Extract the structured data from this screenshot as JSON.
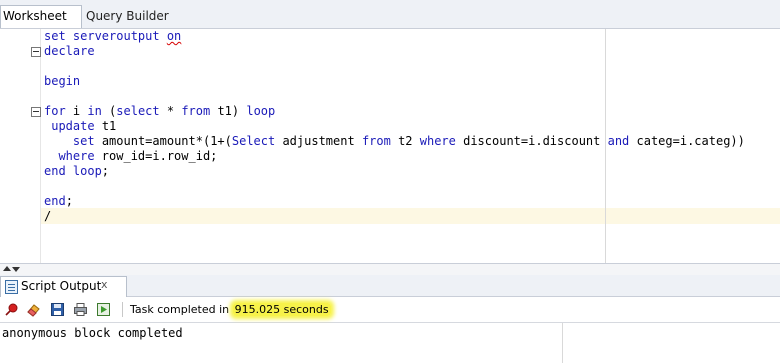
{
  "tabs": [
    {
      "label": "Worksheet"
    },
    {
      "label": "Query Builder"
    }
  ],
  "code_lines": [
    [
      {
        "t": "set serveroutput ",
        "k": 1
      },
      {
        "t": "on",
        "k": 1,
        "s": 1
      }
    ],
    [
      {
        "t": "declare",
        "k": 1
      }
    ],
    [],
    [
      {
        "t": "begin",
        "k": 1
      }
    ],
    [],
    [
      {
        "t": "for",
        "k": 1
      },
      {
        "t": " i "
      },
      {
        "t": "in",
        "k": 1
      },
      {
        "t": " ("
      },
      {
        "t": "select",
        "k": 1
      },
      {
        "t": " * "
      },
      {
        "t": "from",
        "k": 1
      },
      {
        "t": " t1) "
      },
      {
        "t": "loop",
        "k": 1
      }
    ],
    [
      {
        "t": " "
      },
      {
        "t": "update",
        "k": 1
      },
      {
        "t": " t1"
      }
    ],
    [
      {
        "t": "    "
      },
      {
        "t": "set",
        "k": 1
      },
      {
        "t": " amount=amount*(1+("
      },
      {
        "t": "Select",
        "k": 1
      },
      {
        "t": " adjustment "
      },
      {
        "t": "from",
        "k": 1
      },
      {
        "t": " t2 "
      },
      {
        "t": "where",
        "k": 1
      },
      {
        "t": " discount=i.discount "
      },
      {
        "t": "and",
        "k": 1
      },
      {
        "t": " categ=i.categ))"
      }
    ],
    [
      {
        "t": "  "
      },
      {
        "t": "where",
        "k": 1
      },
      {
        "t": " row_id=i.row_id;"
      }
    ],
    [
      {
        "t": "end loop",
        "k": 1
      },
      {
        "t": ";"
      }
    ],
    [],
    [
      {
        "t": "end",
        "k": 1
      },
      {
        "t": ";"
      }
    ],
    [
      {
        "t": "/"
      }
    ]
  ],
  "output_panel": {
    "tab_label": "Script Output",
    "close_glyph": "x",
    "status_prefix": "Task completed in ",
    "status_highlight": "915.025 seconds",
    "output_text": "anonymous block completed"
  },
  "toolbar_icons": [
    "pin-icon",
    "eraser-icon",
    "save-icon",
    "print-icon",
    "open-file-icon"
  ],
  "colors": {
    "keyword": "#1a1ab8",
    "highlight": "#f7f24a",
    "current_line": "#fdf8e3"
  }
}
